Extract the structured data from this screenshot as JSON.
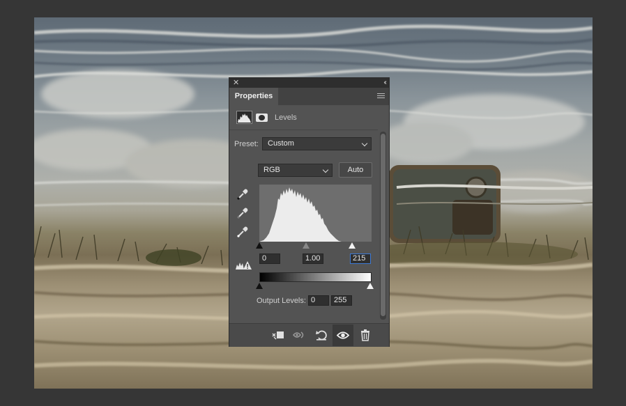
{
  "panel": {
    "tab_label": "Properties",
    "adjustment_title": "Levels",
    "preset_label": "Preset:",
    "preset_value": "Custom",
    "channel_value": "RGB",
    "auto_label": "Auto",
    "input_black": "0",
    "input_gamma": "1.00",
    "input_white": "215",
    "output_label": "Output Levels:",
    "output_black": "0",
    "output_white": "255",
    "close_glyph": "✕",
    "collapse_glyph": "‹‹"
  },
  "icons": [
    "close-icon",
    "collapse-icon",
    "panel-menu-icon",
    "levels-histogram-icon",
    "mask-icon",
    "black-point-eyedropper-icon",
    "gray-point-eyedropper-icon",
    "white-point-eyedropper-icon",
    "clipping-warning-icon",
    "clip-to-layer-icon",
    "view-previous-state-icon",
    "reset-icon",
    "visibility-eye-icon",
    "trash-icon"
  ],
  "colors": {
    "workspace": "#363636",
    "panel_bg": "#535353",
    "input_focus": "#3d7ad6"
  }
}
